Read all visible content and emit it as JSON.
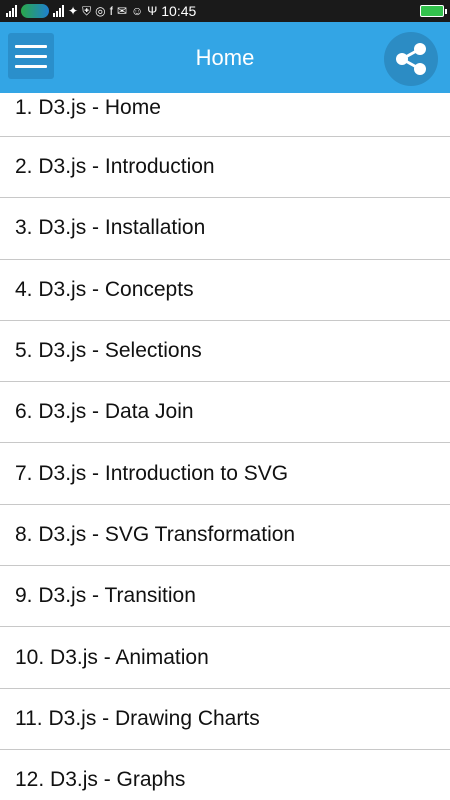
{
  "status_bar": {
    "time": "10:45"
  },
  "app_bar": {
    "title": "Home",
    "menu_icon": "hamburger-menu-icon",
    "share_icon": "share-icon",
    "color": "#33a5e5"
  },
  "topics": [
    "1. D3.js - Home",
    "2. D3.js - Introduction",
    "3. D3.js - Installation",
    "4. D3.js - Concepts",
    "5. D3.js - Selections",
    "6. D3.js - Data Join",
    "7. D3.js - Introduction to SVG",
    "8. D3.js - SVG Transformation",
    "9. D3.js - Transition",
    "10. D3.js - Animation",
    "11. D3.js - Drawing Charts",
    "12. D3.js - Graphs"
  ]
}
